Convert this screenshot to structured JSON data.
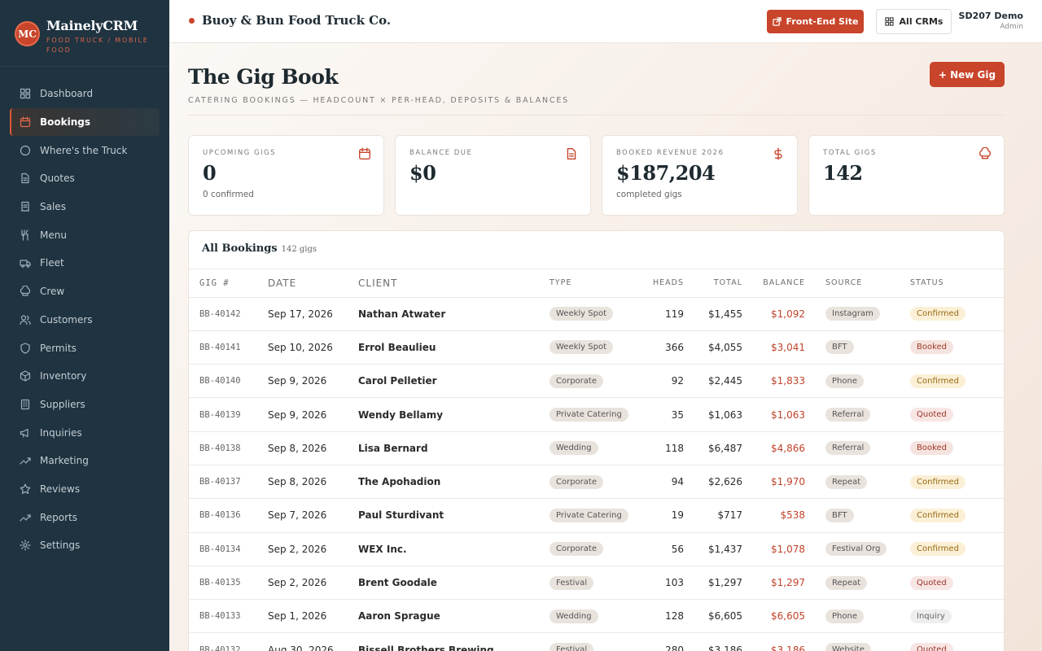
{
  "brand": {
    "logo": "MC",
    "name": "MainelyCRM",
    "subtitle": "FOOD TRUCK / MOBILE FOOD"
  },
  "nav": [
    {
      "label": "Dashboard",
      "icon": "grid-icon",
      "active": false
    },
    {
      "label": "Bookings",
      "icon": "calendar-icon",
      "active": true
    },
    {
      "label": "Where's the Truck",
      "icon": "circle-icon",
      "active": false
    },
    {
      "label": "Quotes",
      "icon": "document-icon",
      "active": false
    },
    {
      "label": "Sales",
      "icon": "receipt-icon",
      "active": false
    },
    {
      "label": "Menu",
      "icon": "utensils-icon",
      "active": false
    },
    {
      "label": "Fleet",
      "icon": "truck-icon",
      "active": false
    },
    {
      "label": "Crew",
      "icon": "chef-hat-icon",
      "active": false
    },
    {
      "label": "Customers",
      "icon": "users-icon",
      "active": false
    },
    {
      "label": "Permits",
      "icon": "shield-icon",
      "active": false
    },
    {
      "label": "Inventory",
      "icon": "box-icon",
      "active": false
    },
    {
      "label": "Suppliers",
      "icon": "building-icon",
      "active": false
    },
    {
      "label": "Inquiries",
      "icon": "megaphone-icon",
      "active": false
    },
    {
      "label": "Marketing",
      "icon": "trending-icon",
      "active": false
    },
    {
      "label": "Reviews",
      "icon": "star-icon",
      "active": false
    },
    {
      "label": "Reports",
      "icon": "chart-icon",
      "active": false
    },
    {
      "label": "Settings",
      "icon": "gear-icon",
      "active": false
    }
  ],
  "topbar": {
    "business_name": "Buoy & Bun Food Truck Co.",
    "front_end_label": "Front-End Site",
    "all_crms_label": "All CRMs",
    "user_name": "SD207 Demo",
    "user_role": "Admin"
  },
  "page": {
    "title": "The Gig Book",
    "subtitle": "CATERING BOOKINGS — HEADCOUNT × PER-HEAD, DEPOSITS & BALANCES",
    "new_button": "+ New Gig"
  },
  "stats": [
    {
      "label": "UPCOMING GIGS",
      "value": "0",
      "note": "0 confirmed",
      "icon": "calendar-icon"
    },
    {
      "label": "BALANCE DUE",
      "value": "$0",
      "note": "",
      "icon": "document-icon"
    },
    {
      "label": "BOOKED REVENUE 2026",
      "value": "$187,204",
      "note": "completed gigs",
      "icon": "dollar-icon"
    },
    {
      "label": "TOTAL GIGS",
      "value": "142",
      "note": "",
      "icon": "chef-hat-icon"
    }
  ],
  "bookings": {
    "title": "All Bookings",
    "count": "142 gigs",
    "columns": [
      "GIG #",
      "DATE",
      "CLIENT",
      "TYPE",
      "HEADS",
      "TOTAL",
      "BALANCE",
      "SOURCE",
      "STATUS"
    ],
    "rows": [
      {
        "gig": "BB-40142",
        "date": "Sep 17, 2026",
        "client": "Nathan Atwater",
        "type": "Weekly Spot",
        "heads": "119",
        "total": "$1,455",
        "balance": "$1,092",
        "source": "Instagram",
        "status": "Confirmed"
      },
      {
        "gig": "BB-40141",
        "date": "Sep 10, 2026",
        "client": "Errol Beaulieu",
        "type": "Weekly Spot",
        "heads": "366",
        "total": "$4,055",
        "balance": "$3,041",
        "source": "BFT",
        "status": "Booked"
      },
      {
        "gig": "BB-40140",
        "date": "Sep 9, 2026",
        "client": "Carol Pelletier",
        "type": "Corporate",
        "heads": "92",
        "total": "$2,445",
        "balance": "$1,833",
        "source": "Phone",
        "status": "Confirmed"
      },
      {
        "gig": "BB-40139",
        "date": "Sep 9, 2026",
        "client": "Wendy Bellamy",
        "type": "Private Catering",
        "heads": "35",
        "total": "$1,063",
        "balance": "$1,063",
        "source": "Referral",
        "status": "Quoted"
      },
      {
        "gig": "BB-40138",
        "date": "Sep 8, 2026",
        "client": "Lisa Bernard",
        "type": "Wedding",
        "heads": "118",
        "total": "$6,487",
        "balance": "$4,866",
        "source": "Referral",
        "status": "Booked"
      },
      {
        "gig": "BB-40137",
        "date": "Sep 8, 2026",
        "client": "The Apohadion",
        "type": "Corporate",
        "heads": "94",
        "total": "$2,626",
        "balance": "$1,970",
        "source": "Repeat",
        "status": "Confirmed"
      },
      {
        "gig": "BB-40136",
        "date": "Sep 7, 2026",
        "client": "Paul Sturdivant",
        "type": "Private Catering",
        "heads": "19",
        "total": "$717",
        "balance": "$538",
        "source": "BFT",
        "status": "Confirmed"
      },
      {
        "gig": "BB-40134",
        "date": "Sep 2, 2026",
        "client": "WEX Inc.",
        "type": "Corporate",
        "heads": "56",
        "total": "$1,437",
        "balance": "$1,078",
        "source": "Festival Org",
        "status": "Confirmed"
      },
      {
        "gig": "BB-40135",
        "date": "Sep 2, 2026",
        "client": "Brent Goodale",
        "type": "Festival",
        "heads": "103",
        "total": "$1,297",
        "balance": "$1,297",
        "source": "Repeat",
        "status": "Quoted"
      },
      {
        "gig": "BB-40133",
        "date": "Sep 1, 2026",
        "client": "Aaron Sprague",
        "type": "Wedding",
        "heads": "128",
        "total": "$6,605",
        "balance": "$6,605",
        "source": "Phone",
        "status": "Inquiry"
      },
      {
        "gig": "BB-40132",
        "date": "Aug 30, 2026",
        "client": "Bissell Brothers Brewing",
        "type": "Festival",
        "heads": "280",
        "total": "$3,186",
        "balance": "$3,186",
        "source": "Website",
        "status": "Quoted"
      }
    ]
  }
}
